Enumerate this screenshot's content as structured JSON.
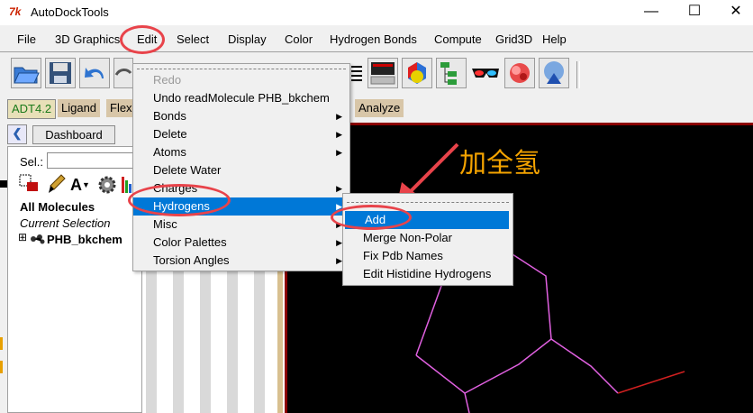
{
  "window": {
    "icon_text": "7k",
    "title": "AutoDockTools",
    "minimize": "—",
    "maximize": "☐",
    "close": "✕"
  },
  "menubar": [
    "File",
    "3D Graphics",
    "Edit",
    "Select",
    "Display",
    "Color",
    "Hydrogen Bonds",
    "Compute",
    "Grid3D",
    "Help"
  ],
  "tabs": [
    "ADT4.2",
    "Ligand",
    "Flex",
    "Analyze"
  ],
  "leftpanel": {
    "dashboard_label": "Dashboard",
    "sel_label": "Sel.:",
    "font_button": "A",
    "all_molecules": "All Molecules",
    "current_selection": "Current Selection",
    "expand": "⊞",
    "molecule": "PHB_bkchem"
  },
  "edit_menu": {
    "items": [
      {
        "label": "Redo",
        "disabled": true,
        "submenu": false
      },
      {
        "label": "Undo readMolecule PHB_bkchem",
        "disabled": false,
        "submenu": false
      },
      {
        "label": "Bonds",
        "disabled": false,
        "submenu": true
      },
      {
        "label": "Delete",
        "disabled": false,
        "submenu": true
      },
      {
        "label": "Atoms",
        "disabled": false,
        "submenu": true
      },
      {
        "label": "Delete Water",
        "disabled": false,
        "submenu": false
      },
      {
        "label": "Charges",
        "disabled": false,
        "submenu": true
      },
      {
        "label": "Hydrogens",
        "disabled": false,
        "submenu": true,
        "selected": true
      },
      {
        "label": "Misc",
        "disabled": false,
        "submenu": true
      },
      {
        "label": "Color Palettes",
        "disabled": false,
        "submenu": true
      },
      {
        "label": "Torsion Angles",
        "disabled": false,
        "submenu": true
      }
    ]
  },
  "hydrogens_submenu": {
    "items": [
      "Add",
      "Merge Non-Polar",
      "Fix Pdb Names",
      "Edit Histidine Hydrogens"
    ]
  },
  "annotation": {
    "text": "加全氢",
    "color": "#f4a300"
  },
  "colors": {
    "accent": "#0078d7",
    "annotation_red": "#e8434a",
    "molecule_line": "#e060e0"
  }
}
